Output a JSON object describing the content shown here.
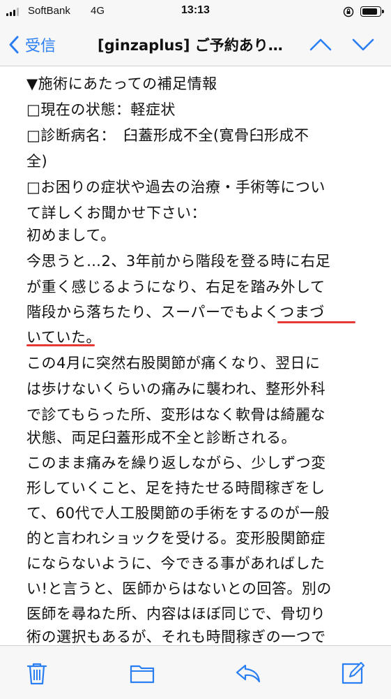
{
  "status_bar": {
    "carrier": "SoftBank",
    "network": "4G",
    "time": "13:13"
  },
  "nav": {
    "back_label": "受信",
    "title": "[ginzaplus] ご予約あり…"
  },
  "email": {
    "lines": [
      "▼施術にあたっての補足情報",
      "□現在の状態：軽症状",
      "□診断病名：　臼蓋形成不全(寛骨臼形成不",
      "全)",
      "□お困りの症状や過去の治療・手術等につい",
      "て詳しくお聞かせ下さい：",
      "初めまして。",
      "今思うと…2、3年前から階段を登る時に右足",
      "が重く感じるようになり、右足を踏み外して",
      "階段から落ちたり、スーパーでもよくつまづ",
      "いていた。",
      "この4月に突然右股関節が痛くなり、翌日に",
      "は歩けないくらいの痛みに襲われ、整形外科",
      "で診てもらった所、変形はなく軟骨は綺麗な",
      "状態、両足臼蓋形成不全と診断される。",
      "このまま痛みを繰り返しながら、少しずつ変",
      "形していくこと、足を持たせる時間稼ぎをし",
      "て、60代で人工股関節の手術をするのが一般",
      "的と言われショックを受ける。変形股関節症",
      "にならないように、今できる事があればした",
      "い!と言うと、医師からはないとの回答。別の",
      "医師を尋ねた所、内容はほぼ同じで、骨切り",
      "術の選択もあるが、それも時間稼ぎの一つで"
    ]
  },
  "colors": {
    "accent": "#2a7ef3",
    "underline": "#e53935"
  },
  "toolbar": {
    "icons": [
      "trash-icon",
      "folder-icon",
      "reply-icon",
      "compose-icon"
    ]
  }
}
